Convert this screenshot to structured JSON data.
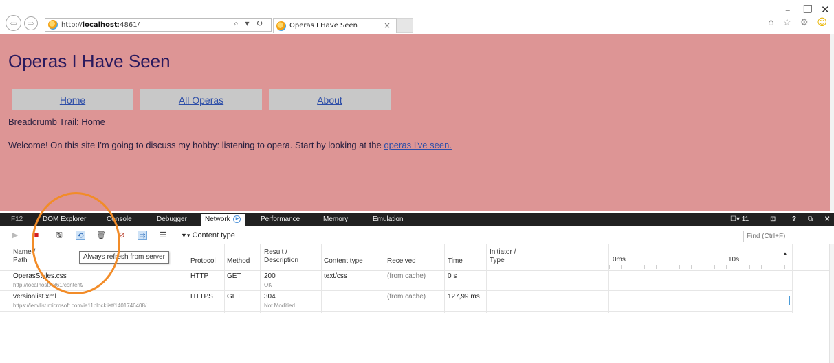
{
  "browser": {
    "url_host": "localhost",
    "url_prefix": "http://",
    "url_suffix": ":4861/",
    "tab_title": "Operas I Have Seen",
    "icons": {
      "back": "back-arrow-icon",
      "forward": "forward-arrow-icon",
      "search": "search-icon",
      "refresh": "refresh-icon",
      "home": "home-icon",
      "favorites": "star-icon",
      "settings": "gear-icon",
      "feedback": "smiley-icon"
    },
    "glyphs": {
      "back": "⇦",
      "forward": "⇨",
      "addr_tools": "⌕ ▾ ↻",
      "close": "×",
      "minimize": "–",
      "restore": "❐",
      "window_close": "✕",
      "toolbar_right": "⌂ ☆ ⚙ ",
      "smiley": "☺"
    }
  },
  "page": {
    "title": "Operas I Have Seen",
    "menu": [
      "Home",
      "All Operas",
      "About"
    ],
    "breadcrumb": "Breadcrumb Trail: Home",
    "welcome_text": "Welcome! On this site I'm going to discuss my hobby: listening to opera. Start by looking at the ",
    "welcome_link": "operas I've seen.",
    "colors": {
      "background": "#dd9595",
      "menu_bg": "#c8c8c8",
      "title": "#2a1a5e",
      "link": "#2d4ea8"
    }
  },
  "devtools": {
    "tabs": [
      "F12",
      "DOM Explorer",
      "Console",
      "Debugger",
      "Network",
      "Performance",
      "Memory",
      "Emulation"
    ],
    "active_tab": "Network",
    "right_items": {
      "screen": "☐▾ 11",
      "console_icon": "⊡",
      "help": "?",
      "dock": "⧉",
      "close": "✕"
    },
    "toolbar": {
      "glyphs": [
        "▶",
        "■",
        "🖫",
        "⟲",
        "🗑",
        "⊘",
        "⇉",
        "☰"
      ],
      "filter_icon": "▼▾",
      "filter_label": "Content type",
      "find_placeholder": "Find (Ctrl+F)",
      "tooltip": "Always refresh from server"
    },
    "columns": {
      "name": [
        "Name /",
        "Path"
      ],
      "protocol": "Protocol",
      "method": "Method",
      "result": [
        "Result /",
        "Description"
      ],
      "content_type": "Content type",
      "received": "Received",
      "time": "Time",
      "initiator": [
        "Initiator /",
        "Type"
      ],
      "timeline_start": "0ms",
      "timeline_end": "10s",
      "sort_icon": "▲"
    },
    "rows": [
      {
        "name": "OperasStyles.css",
        "path": "http://localhost:4861/content/",
        "protocol": "HTTP",
        "method": "GET",
        "result": "200",
        "description": "OK",
        "content_type": "text/css",
        "received": "(from cache)",
        "time": "0 s",
        "initiator": "",
        "type": ""
      },
      {
        "name": "versionlist.xml",
        "path": "https://iecvlist.microsoft.com/ie11blocklist/1401746408/",
        "protocol": "HTTPS",
        "method": "GET",
        "result": "304",
        "description": "Not Modified",
        "content_type": "",
        "received": "(from cache)",
        "time": "127,99 ms",
        "initiator": "",
        "type": ""
      }
    ]
  }
}
